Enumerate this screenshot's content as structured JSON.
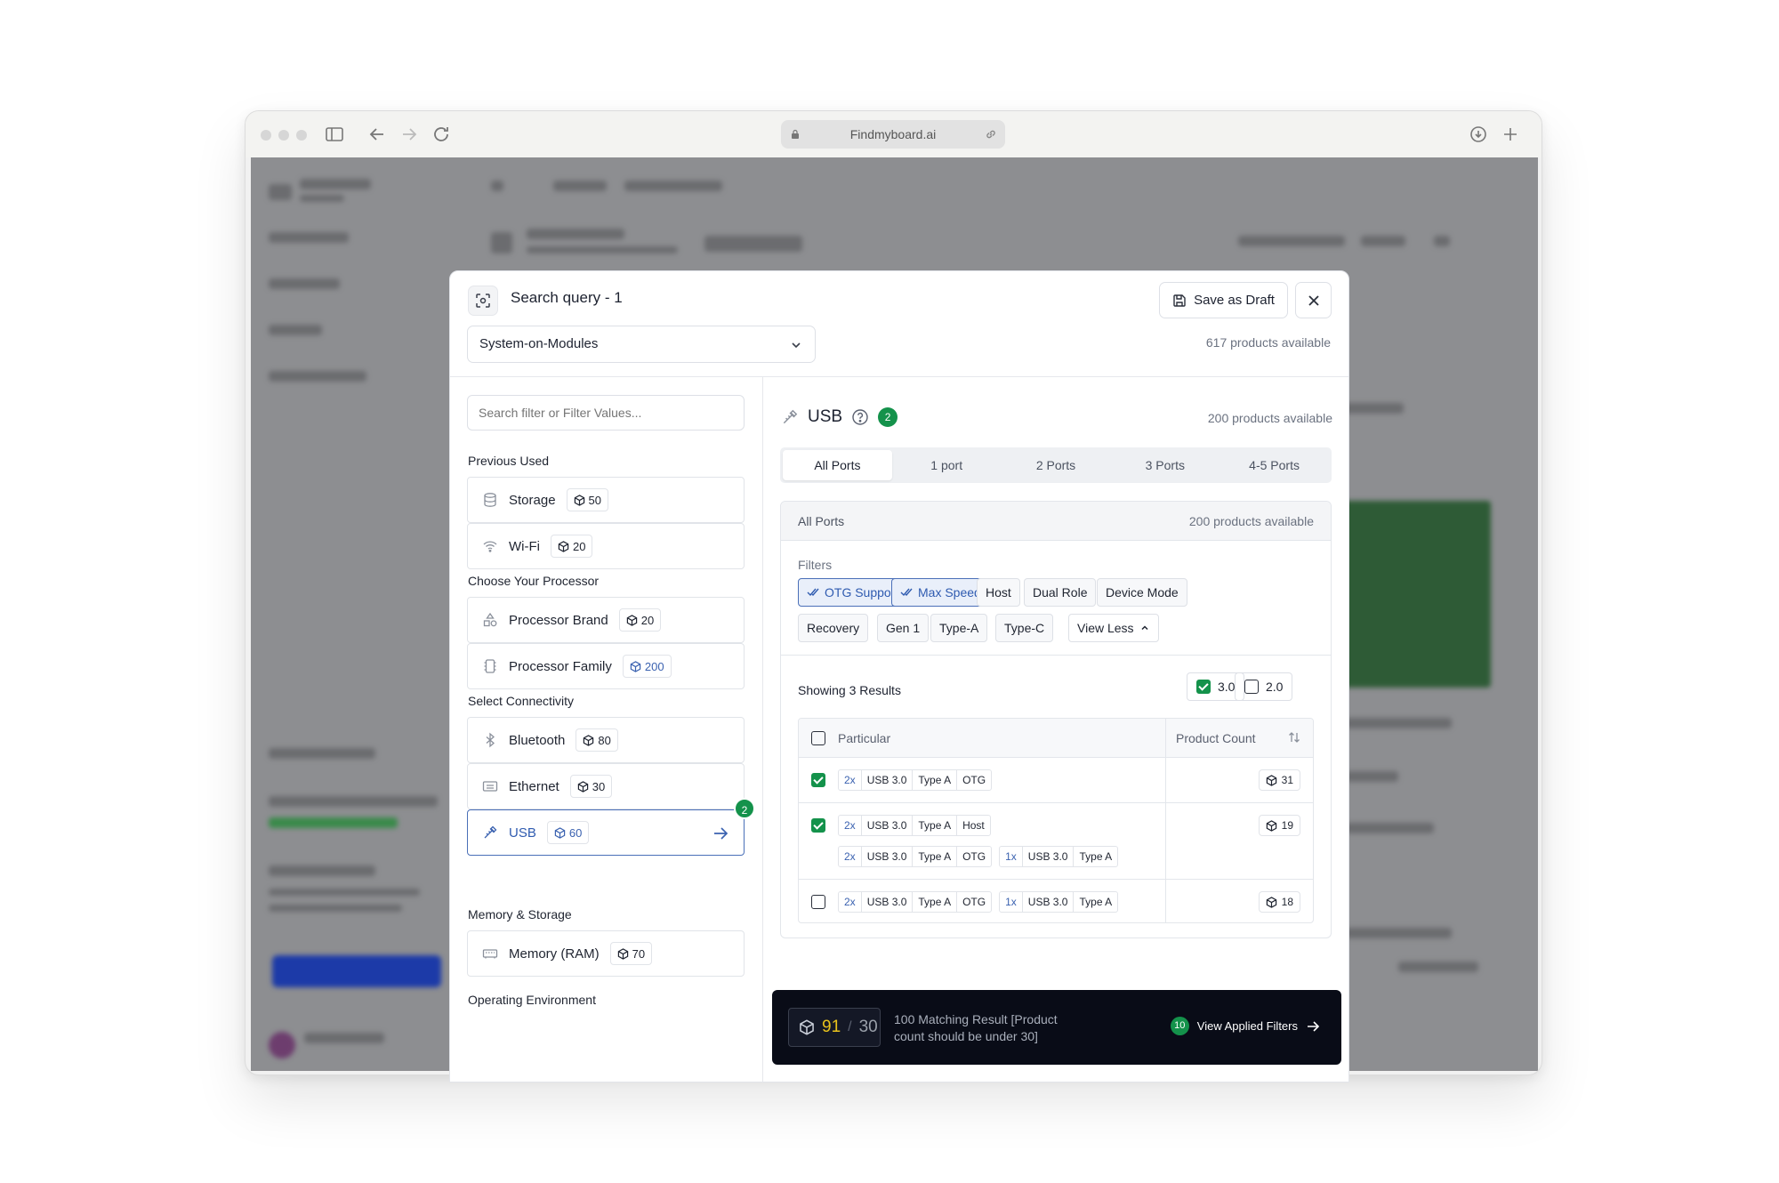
{
  "browser": {
    "url": "Findmyboard.ai"
  },
  "modal": {
    "title": "Search query - 1",
    "save_label": "Save as Draft",
    "category": "System-on-Modules",
    "available": "617 products available"
  },
  "left": {
    "search_placeholder": "Search filter or Filter Values...",
    "sections": {
      "previous": "Previous Used",
      "processor": "Choose Your Processor",
      "connectivity": "Select Connectivity",
      "memory": "Memory & Storage",
      "environment": "Operating Environment"
    },
    "items": {
      "storage": {
        "label": "Storage",
        "count": "50"
      },
      "wifi": {
        "label": "Wi-Fi",
        "count": "20"
      },
      "brand": {
        "label": "Processor Brand",
        "count": "20"
      },
      "family": {
        "label": "Processor Family",
        "count": "200"
      },
      "bluetooth": {
        "label": "Bluetooth",
        "count": "80"
      },
      "ethernet": {
        "label": "Ethernet",
        "count": "30"
      },
      "usb": {
        "label": "USB",
        "count": "60",
        "applied": "2"
      },
      "ram": {
        "label": "Memory (RAM)",
        "count": "70"
      }
    }
  },
  "right": {
    "title": "USB",
    "applied": "2",
    "available": "200 products available",
    "tabs": [
      "All Ports",
      "1 port",
      "2 Ports",
      "3 Ports",
      "4-5 Ports"
    ],
    "ports": {
      "title": "All Ports",
      "available": "200 products available",
      "filters_label": "Filters",
      "chips": [
        "OTG Support",
        "Max Speed",
        "Host",
        "Dual Role",
        "Device Mode",
        "Recovery",
        "Gen 1",
        "Type-A",
        "Type-C"
      ],
      "view_less": "View Less",
      "showing": "Showing 3 Results",
      "versions": [
        "3.0",
        "2.0"
      ],
      "table": {
        "col_particular": "Particular",
        "col_count": "Product Count",
        "rows": [
          {
            "checked": true,
            "lines": [
              [
                [
                  "2x",
                  "USB 3.0",
                  "Type A",
                  "OTG"
                ]
              ]
            ],
            "count": "31"
          },
          {
            "checked": true,
            "lines": [
              [
                [
                  "2x",
                  "USB 3.0",
                  "Type A",
                  "Host"
                ]
              ],
              [
                [
                  "2x",
                  "USB 3.0",
                  "Type A",
                  "OTG"
                ],
                [
                  "1x",
                  "USB 3.0",
                  "Type A"
                ]
              ]
            ],
            "count": "19"
          },
          {
            "checked": false,
            "lines": [
              [
                [
                  "2x",
                  "USB 3.0",
                  "Type A",
                  "OTG"
                ],
                [
                  "1x",
                  "USB 3.0",
                  "Type A"
                ]
              ]
            ],
            "count": "18"
          }
        ]
      }
    },
    "summary": {
      "matching": "91",
      "limit": "30",
      "text": "100 Matching Result [Product count should be under 30]",
      "applied": "10",
      "button": "View Applied Filters"
    }
  }
}
